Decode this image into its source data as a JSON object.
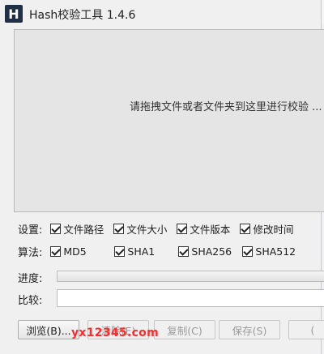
{
  "window": {
    "title": "Hash校验工具 1.4.6",
    "icon_letter": "H"
  },
  "drop_area": {
    "hint": "请拖拽文件或者文件夹到这里进行校验 ..."
  },
  "settings": {
    "label": "设置:",
    "options": [
      {
        "label": "文件路径",
        "checked": true
      },
      {
        "label": "文件大小",
        "checked": true
      },
      {
        "label": "文件版本",
        "checked": true
      },
      {
        "label": "修改时间",
        "checked": true
      }
    ]
  },
  "algorithms": {
    "label": "算法:",
    "options": [
      {
        "label": "MD5",
        "checked": true
      },
      {
        "label": "SHA1",
        "checked": true
      },
      {
        "label": "SHA256",
        "checked": true
      },
      {
        "label": "SHA512",
        "checked": true
      }
    ]
  },
  "progress": {
    "label": "进度:",
    "value": 0
  },
  "compare": {
    "label": "比较:",
    "value": ""
  },
  "buttons": {
    "browse": "浏览(B)...",
    "clear": "清除(E)",
    "copy": "复制(C)",
    "save": "保存(S)",
    "extra": "("
  },
  "watermark": "yx12345.com"
}
